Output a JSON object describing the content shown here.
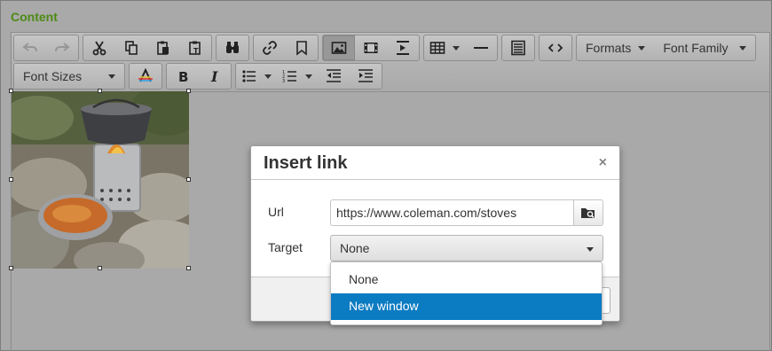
{
  "page": {
    "section_label": "Content"
  },
  "toolbar": {
    "formats_label": "Formats",
    "font_family_label": "Font Family",
    "font_sizes_label": "Font Sizes",
    "row1": [
      [
        "undo-icon",
        "redo-icon"
      ],
      [
        "cut-icon",
        "copy-icon",
        "paste-icon",
        "paste-text-icon"
      ],
      [
        "find-icon"
      ],
      [
        "link-icon",
        "bookmark-icon"
      ],
      [
        "image-icon",
        "media-icon",
        "page-break-icon"
      ],
      [
        "table-icon",
        "horizontal-rule-icon"
      ],
      [
        "template-icon"
      ],
      [
        "source-code-icon"
      ]
    ],
    "row2": [
      [
        "text-color-icon"
      ],
      [
        "bold-icon",
        "italic-icon"
      ],
      [
        "bullet-list-icon",
        "numbered-list-icon",
        "outdent-icon",
        "indent-icon"
      ]
    ]
  },
  "editor_image": {
    "alt": "camp stove photo"
  },
  "dialog": {
    "title": "Insert link",
    "close_glyph": "×",
    "url_label": "Url",
    "url_value": "https://www.coleman.com/stoves",
    "target_label": "Target",
    "target_value": "None",
    "target_options": [
      "None",
      "New window"
    ],
    "highlighted_option": "New window"
  },
  "colors": {
    "accent": "#0b7bc2",
    "section_label": "#4e8a16",
    "backdrop": "#a9a9a9"
  }
}
